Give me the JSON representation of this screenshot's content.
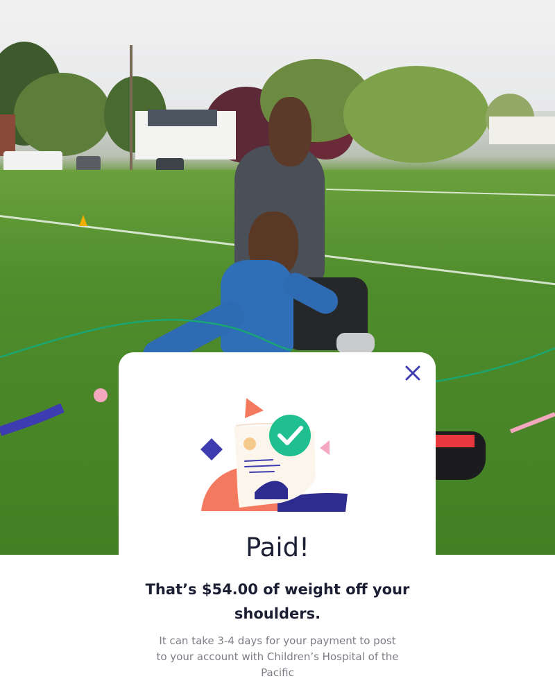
{
  "modal": {
    "close_icon": "close-icon",
    "illustration_icon": "paid-receipt-checkmark-illustration",
    "title": "Paid!",
    "headline": "That’s $54.00 of weight off your shoulders.",
    "description": "It can take 3-4 days for your payment to post to your account with Children’s Hospital of the Pacific"
  },
  "colors": {
    "close": "#3d3cb0",
    "check_circle": "#1fbf8f",
    "coral": "#f47a5f",
    "navy": "#2e2c8f",
    "pink": "#f4a8bf",
    "green_line": "#1aa672",
    "text_dark": "#1c1f33",
    "text_muted": "#7d7e85"
  },
  "hero": {
    "image": "photo-father-and-son-playing-soccer-on-grass-field"
  }
}
